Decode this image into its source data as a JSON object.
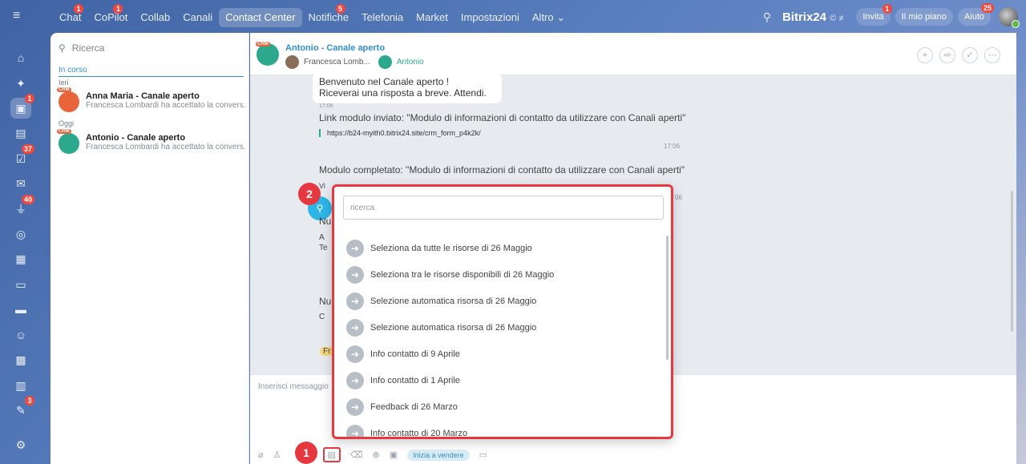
{
  "topnav": {
    "tabs": [
      {
        "label": "Chat",
        "badge": "1"
      },
      {
        "label": "CoPilot",
        "badge": "1"
      },
      {
        "label": "Collab",
        "badge": ""
      },
      {
        "label": "Canali",
        "badge": ""
      },
      {
        "label": "Contact Center",
        "badge": "",
        "active": true
      },
      {
        "label": "Notifiche",
        "badge": "5"
      },
      {
        "label": "Telefonia",
        "badge": ""
      },
      {
        "label": "Market",
        "badge": ""
      },
      {
        "label": "Impostazioni",
        "badge": ""
      },
      {
        "label": "Altro ⌄",
        "badge": ""
      }
    ],
    "brand": "Bitrix24",
    "brand_suffix": "© ≠",
    "invite_label": "Invita",
    "invite_badge": "1",
    "plan_label": "Il mio piano",
    "help_label": "Aiuto",
    "help_badge": "25"
  },
  "leftbar": {
    "badges": {
      "chat": "1",
      "tasks": "37",
      "feed": "40",
      "notes": "3"
    }
  },
  "sidebar": {
    "search_placeholder": "Ricerca",
    "section": "In corso",
    "day1": "Ieri",
    "day2": "Oggi",
    "conversations": [
      {
        "title": "Anna Maria - Canale aperto",
        "subtitle": "Francesca Lombardi ha accettato la convers...",
        "crm": "CRM",
        "color": "#e8643a"
      },
      {
        "title": "Antonio - Canale aperto",
        "subtitle": "Francesca Lombardi ha accettato la convers...",
        "crm": "CRM",
        "color": "#2ca98c"
      }
    ]
  },
  "chat": {
    "crm": "CRM",
    "title": "Antonio - Canale aperto",
    "operator": "Francesca Lomb...",
    "client": "Antonio",
    "welcome_line1": "Benvenuto nel Canale aperto !",
    "welcome_line2": "Riceverai una risposta a breve. Attendi.",
    "welcome_time": "17:06",
    "form_link_msg": "Link modulo inviato: \"Modulo di informazioni di contatto da utilizzare con Canali aperti\"",
    "form_link_url": "https://b24-myith0.bitrix24.site/crm_form_p4k2k/",
    "form_link_time": "17:06",
    "form_done_msg": "Modulo completato: \"Modulo di informazioni di contatto da utilizzare con Canali aperti\"",
    "form_done_time": "06",
    "partial_1": "Vi",
    "partial_2": "Nu",
    "partial_3": "A",
    "partial_4": "Te",
    "partial_5": "Nu",
    "partial_6": "C",
    "partial_7": "Fr",
    "composer_placeholder": "Inserisci messaggio",
    "sell_label": "Inizia a vendere"
  },
  "popup": {
    "search_placeholder": "ricerca",
    "items": [
      "Seleziona da tutte le risorse di 26 Maggio",
      "Seleziona tra le risorse disponibili di 26 Maggio",
      "Selezione automatica risorsa di 26 Maggio",
      "Selezione automatica risorsa di 26 Maggio",
      "Info contatto di 9 Aprile",
      "Info contatto di 1 Aprile",
      "Feedback di 26 Marzo",
      "Info contatto di 20 Marzo"
    ]
  },
  "callouts": {
    "one": "1",
    "two": "2"
  }
}
